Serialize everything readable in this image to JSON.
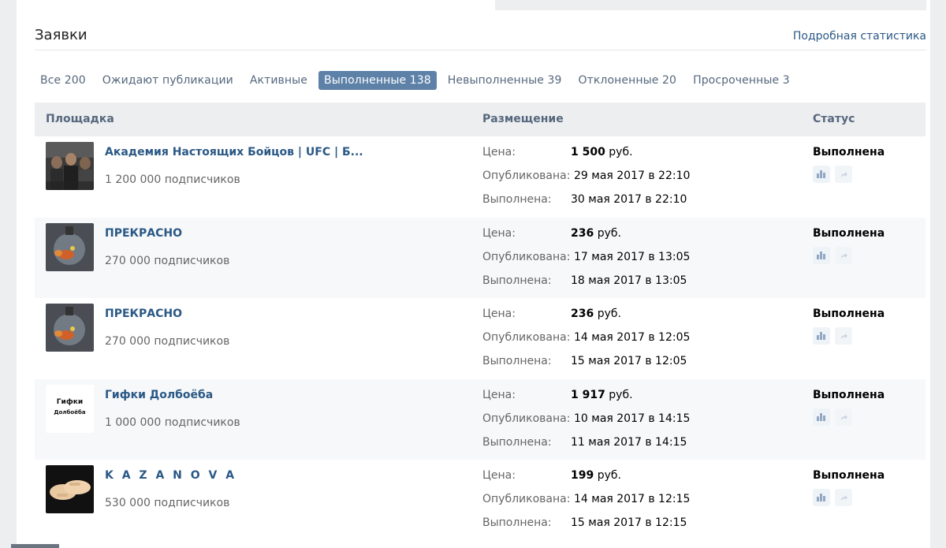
{
  "header": {
    "title": "Заявки",
    "stats_link": "Подробная статистика"
  },
  "tabs": [
    {
      "label": "Все 200",
      "active": false
    },
    {
      "label": "Ожидают публикации",
      "active": false
    },
    {
      "label": "Активные",
      "active": false
    },
    {
      "label": "Выполненные 138",
      "active": true
    },
    {
      "label": "Невыполненные 39",
      "active": false
    },
    {
      "label": "Отклоненные 20",
      "active": false
    },
    {
      "label": "Просроченные 3",
      "active": false
    }
  ],
  "table": {
    "columns": {
      "site": "Площадка",
      "placement": "Размещение",
      "status": "Статус"
    },
    "labels": {
      "price": "Цена:",
      "published": "Опубликована:",
      "completed": "Выполнена:",
      "currency": "руб."
    },
    "rows": [
      {
        "name": "Академия Настоящих Бойцов | UFC | Б...",
        "subscribers": "1 200 000 подписчиков",
        "price": "1 500",
        "published": "29 мая 2017 в 22:10",
        "completed": "30 мая 2017 в 22:10",
        "status": "Выполнена",
        "avatar_icon": "fighters-photo-icon"
      },
      {
        "name": "ПРЕКРАСНО",
        "subscribers": "270 000 подписчиков",
        "price": "236",
        "published": "17 мая 2017 в 13:05",
        "completed": "18 мая 2017 в 13:05",
        "status": "Выполнена",
        "avatar_icon": "lightbulb-fish-icon"
      },
      {
        "name": "ПРЕКРАСНО",
        "subscribers": "270 000 подписчиков",
        "price": "236",
        "published": "14 мая 2017 в 12:05",
        "completed": "15 мая 2017 в 12:05",
        "status": "Выполнена",
        "avatar_icon": "lightbulb-fish-icon"
      },
      {
        "name": "Гифки Долбоёба",
        "subscribers": "1 000 000 подписчиков",
        "price": "1 917",
        "published": "10 мая 2017 в 14:15",
        "completed": "11 мая 2017 в 14:15",
        "status": "Выполнена",
        "avatar_text_1": "Гифки",
        "avatar_text_2": "Долбоёба",
        "avatar_icon": "text-logo-icon"
      },
      {
        "name": "K A Z A N O V A",
        "subscribers": "530 000 подписчиков",
        "price": "199",
        "published": "14 мая 2017 в 12:15",
        "completed": "15 мая 2017 в 12:15",
        "status": "Выполнена",
        "avatar_icon": "hands-icon"
      }
    ]
  },
  "colors": {
    "link": "#2a5885",
    "active_tab": "#5e81a8",
    "header_bg": "#edeef0",
    "alt_row_bg": "#f7f8fa"
  }
}
